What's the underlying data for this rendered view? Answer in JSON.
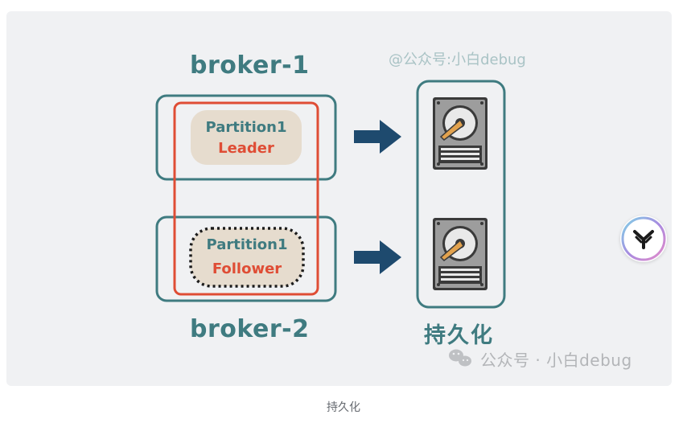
{
  "diagram": {
    "broker1_title": "broker-1",
    "broker2_title": "broker-2",
    "partition_leader_name": "Partition1",
    "partition_leader_role": "Leader",
    "partition_follower_name": "Partition1",
    "partition_follower_role": "Follower",
    "persistence_title": "持久化",
    "watermark_top": "@公众号:小白debug",
    "watermark_bottom": "公众号 · 小白debug",
    "colors": {
      "teal": "#3f7b80",
      "red": "#df4d35",
      "navy_arrow": "#1e4a6e",
      "pill": "#e6dcce",
      "panel": "#f0f1f3"
    },
    "icons": [
      "arrow-right-icon",
      "hard-disk-icon",
      "wechat-icon",
      "app-logo-icon"
    ]
  },
  "caption": "持久化"
}
